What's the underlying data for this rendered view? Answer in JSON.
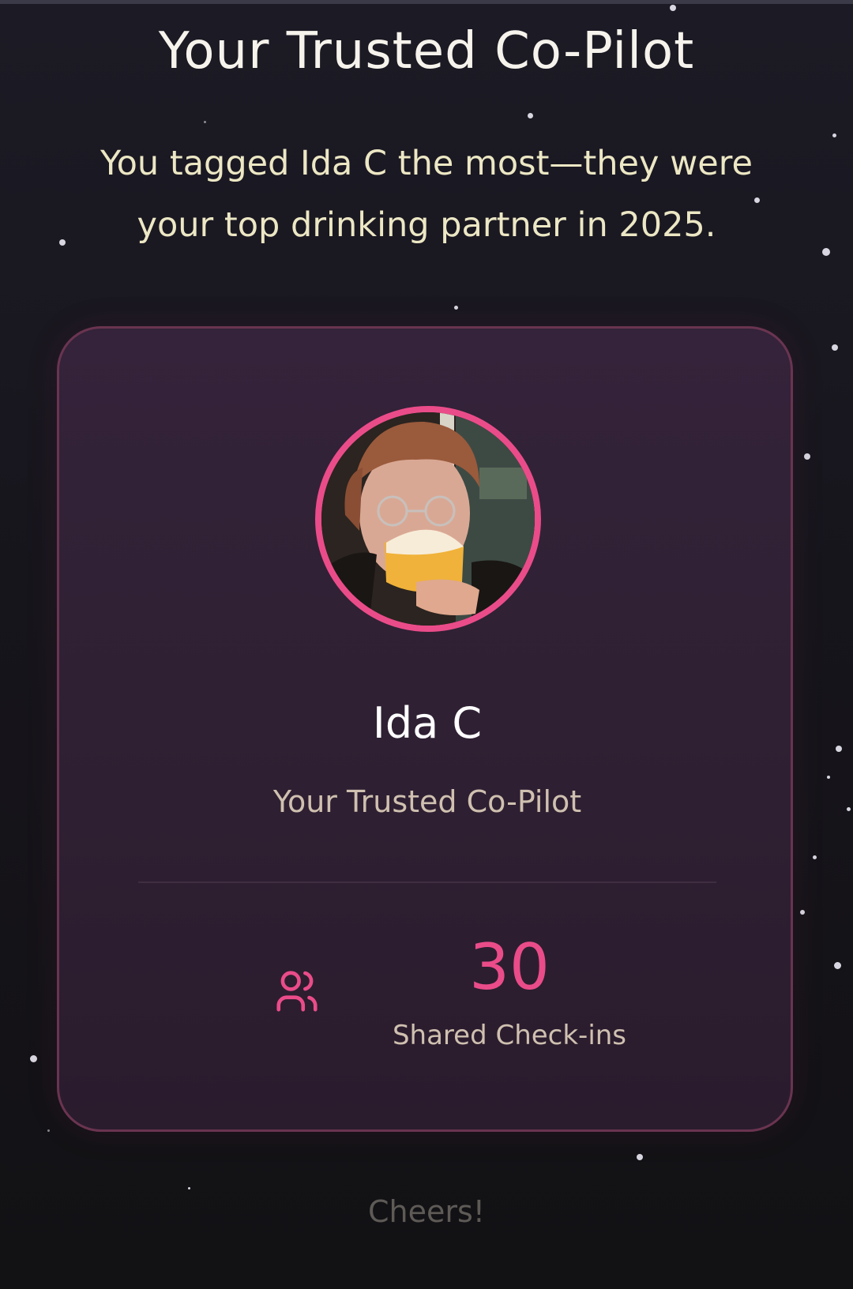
{
  "page": {
    "title": "Your Trusted Co-Pilot",
    "subtitle": "You tagged Ida C the most—they were your top drinking partner in 2025."
  },
  "card": {
    "avatar_alt": "Ida C",
    "name": "Ida C",
    "role": "Your Trusted Co-Pilot",
    "stat": {
      "icon": "users-icon",
      "value": "30",
      "label": "Shared Check-ins"
    }
  },
  "footer": {
    "text": "Cheers!"
  },
  "colors": {
    "accent": "#ea4c89",
    "background": "#17151c",
    "card_background": "#2f2033",
    "card_border": "#6a3450",
    "heading_text": "#f6f3ec",
    "subtitle_text": "#ece7c4",
    "muted_text": "#cfc0b0",
    "footer_text": "#5e5a56"
  }
}
